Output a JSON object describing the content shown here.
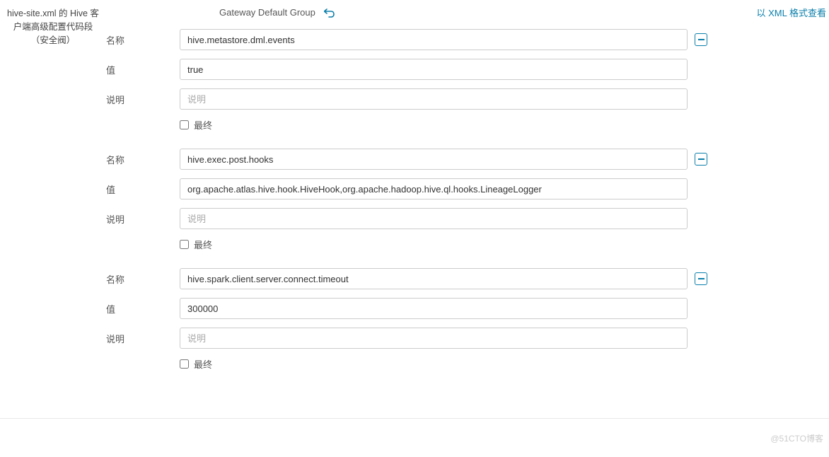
{
  "sidebar": {
    "title_line1": "hive-site.xml 的 Hive 客户端高级配置代码段",
    "title_line2": "（安全阀）"
  },
  "header": {
    "group_name": "Gateway Default Group",
    "xml_link": "以 XML 格式查看"
  },
  "labels": {
    "name": "名称",
    "value": "值",
    "desc": "说明",
    "desc_placeholder": "说明",
    "final": "最终"
  },
  "properties": [
    {
      "name": "hive.metastore.dml.events",
      "value": "true",
      "desc": "",
      "final": false
    },
    {
      "name": "hive.exec.post.hooks",
      "value": "org.apache.atlas.hive.hook.HiveHook,org.apache.hadoop.hive.ql.hooks.LineageLogger",
      "desc": "",
      "final": false
    },
    {
      "name": "hive.spark.client.server.connect.timeout",
      "value": "300000",
      "desc": "",
      "final": false
    }
  ],
  "watermark": "@51CTO博客"
}
